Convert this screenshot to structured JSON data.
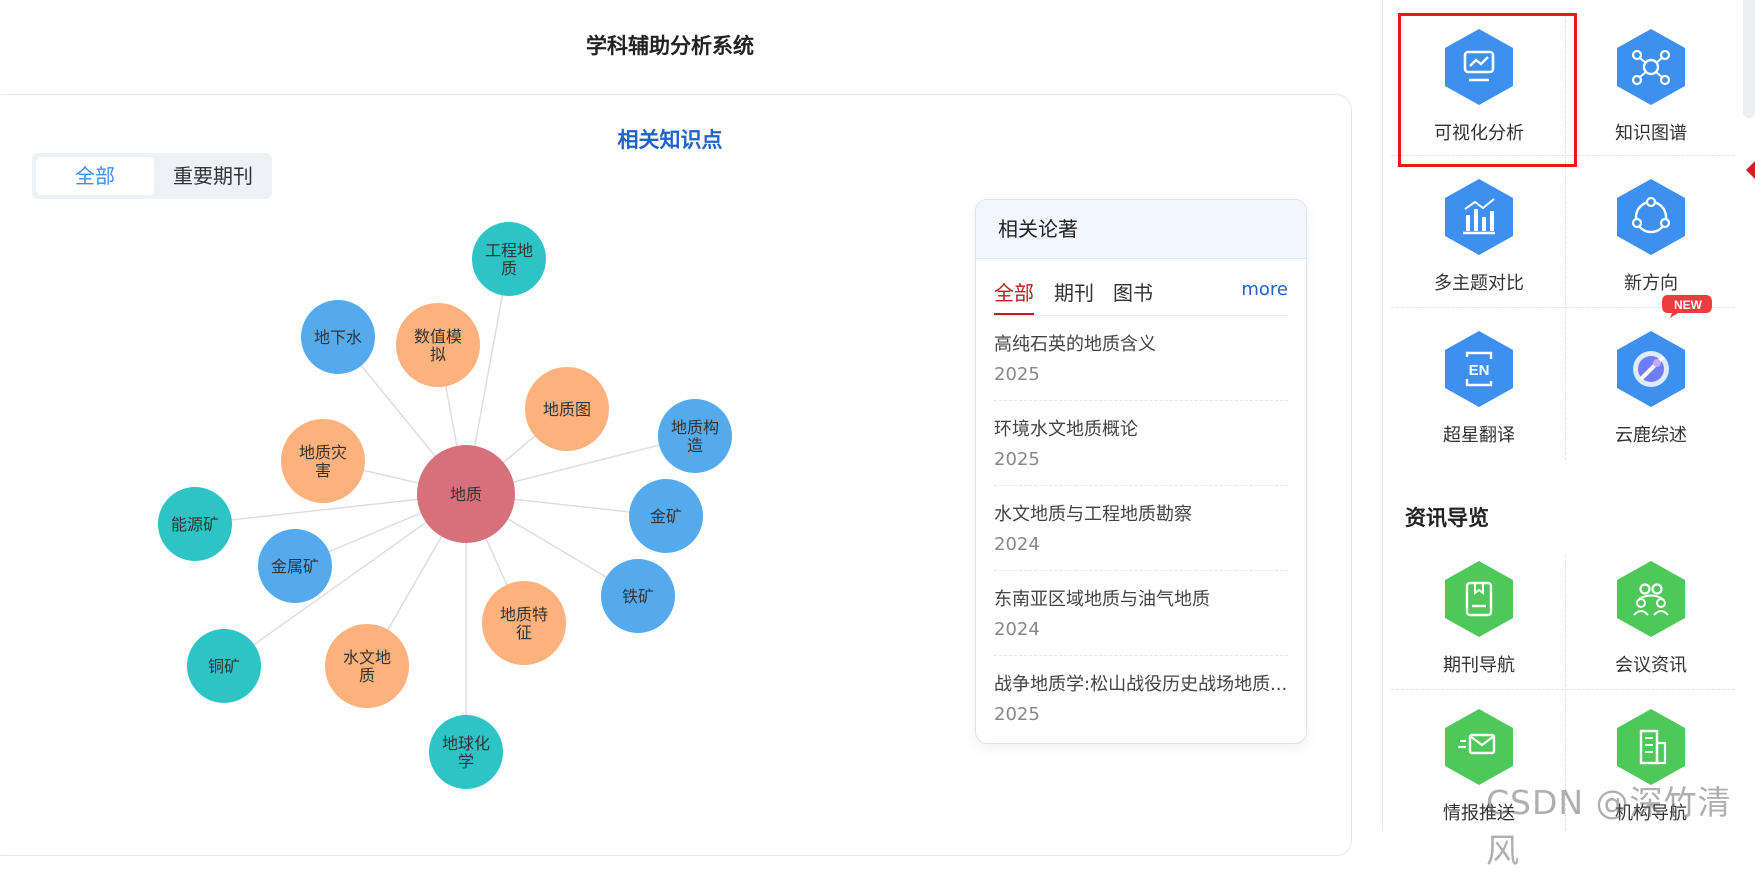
{
  "page": {
    "title": "学科辅助分析系统"
  },
  "knowledge": {
    "title": "相关知识点",
    "tabs": [
      {
        "label": "全部",
        "active": true
      },
      {
        "label": "重要期刊",
        "active": false
      }
    ],
    "center": {
      "label": "地质",
      "color": "#d6707a"
    },
    "nodes": [
      {
        "lines": [
          "工程地",
          "质"
        ],
        "color": "#2ec4c6"
      },
      {
        "lines": [
          "地下水"
        ],
        "color": "#55aaee"
      },
      {
        "lines": [
          "数值模",
          "拟"
        ],
        "color": "#fdb17c"
      },
      {
        "lines": [
          "地质图"
        ],
        "color": "#fdb17c"
      },
      {
        "lines": [
          "地质构",
          "造"
        ],
        "color": "#55aaee"
      },
      {
        "lines": [
          "地质灾",
          "害"
        ],
        "color": "#fdb17c"
      },
      {
        "lines": [
          "金矿"
        ],
        "color": "#55aaee"
      },
      {
        "lines": [
          "能源矿"
        ],
        "color": "#2ec4c6"
      },
      {
        "lines": [
          "金属矿"
        ],
        "color": "#55aaee"
      },
      {
        "lines": [
          "铁矿"
        ],
        "color": "#55aaee"
      },
      {
        "lines": [
          "地质特",
          "征"
        ],
        "color": "#fdb17c"
      },
      {
        "lines": [
          "铜矿"
        ],
        "color": "#2ec4c6"
      },
      {
        "lines": [
          "水文地",
          "质"
        ],
        "color": "#fdb17c"
      },
      {
        "lines": [
          "地球化",
          "学"
        ],
        "color": "#2ec4c6"
      }
    ]
  },
  "literature": {
    "title": "相关论著",
    "tabs": [
      "全部",
      "期刊",
      "图书"
    ],
    "more": "more",
    "items": [
      {
        "title": "高纯石英的地质含义",
        "year": "2025"
      },
      {
        "title": "环境水文地质概论",
        "year": "2025"
      },
      {
        "title": "水文地质与工程地质勘察",
        "year": "2024"
      },
      {
        "title": "东南亚区域地质与油气地质",
        "year": "2024"
      },
      {
        "title": "战争地质学:松山战役历史战场地质...",
        "year": "2025"
      }
    ]
  },
  "sidebar": {
    "tools": [
      {
        "label": "可视化分析",
        "icon": "monitor-chart-icon",
        "highlighted": true
      },
      {
        "label": "知识图谱",
        "icon": "network-graph-icon"
      },
      {
        "label": "多主题对比",
        "icon": "bar-chart-compare-icon"
      },
      {
        "label": "新方向",
        "icon": "direction-circle-icon"
      },
      {
        "label": "超星翻译",
        "icon": "translate-en-icon"
      },
      {
        "label": "云鹿综述",
        "icon": "cloud-deer-icon",
        "badge": "NEW"
      }
    ],
    "section_title": "资讯导览",
    "news": [
      {
        "label": "期刊导航",
        "icon": "journal-book-icon"
      },
      {
        "label": "会议资讯",
        "icon": "meeting-people-icon"
      },
      {
        "label": "情报推送",
        "icon": "mail-send-icon"
      },
      {
        "label": "机构导航",
        "icon": "building-icon"
      }
    ]
  },
  "watermark": "CSDN @深竹清风",
  "colors": {
    "accent_blue": "#1f63c9",
    "tool_blue": "#3d8ff0",
    "tool_green": "#4fc85a",
    "highlight_red": "#e8191c",
    "active_tab_red": "#b22222"
  }
}
